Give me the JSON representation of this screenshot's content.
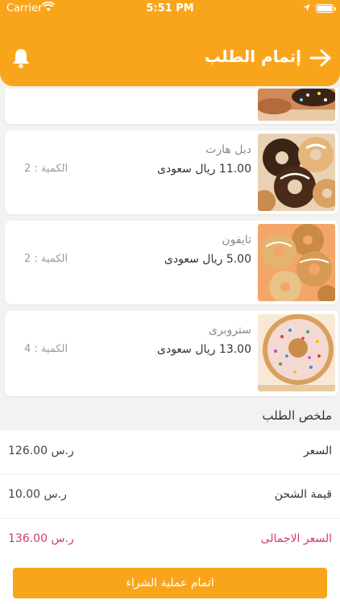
{
  "status_bar": {
    "carrier": "Carrier",
    "time": "5:51 PM"
  },
  "header": {
    "title": "إتمام الطلب"
  },
  "cart_items": [
    {
      "name": "",
      "price": "",
      "quantity": ""
    },
    {
      "name": "دبل هارت",
      "price": "11.00 ريال سعودى",
      "quantity": "الكمية : 2"
    },
    {
      "name": "تايفون",
      "price": "5.00 ريال سعودى",
      "quantity": "الكمية : 2"
    },
    {
      "name": "ستروبرى",
      "price": "13.00 ريال سعودى",
      "quantity": "الكمية : 4"
    }
  ],
  "summary": {
    "title": "ملخص الطلب",
    "price_label": "السعر",
    "price_value": "126.00 ر.س",
    "shipping_label": "قيمة الشحن",
    "shipping_value": "10.00 ر.س",
    "total_label": "السعر الاجمالى",
    "total_value": "136.00 ر.س"
  },
  "checkout_button": "اتمام عملية الشراء",
  "colors": {
    "accent": "#f9a51b",
    "total": "#d63a6b"
  }
}
